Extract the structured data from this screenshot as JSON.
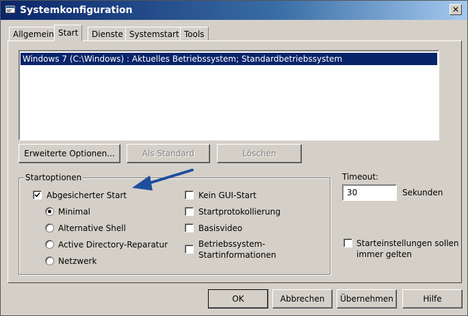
{
  "window": {
    "title": "Systemkonfiguration",
    "close_glyph": "✕"
  },
  "tabs": [
    {
      "label": "Allgemein",
      "active": false
    },
    {
      "label": "Start",
      "active": true
    },
    {
      "label": "Dienste",
      "active": false
    },
    {
      "label": "Systemstart",
      "active": false
    },
    {
      "label": "Tools",
      "active": false
    }
  ],
  "boot_list": {
    "items": [
      "Windows 7 (C:\\Windows) : Aktuelles Betriebssystem; Standardbetriebssystem"
    ],
    "selected_index": 0
  },
  "boot_buttons": {
    "advanced": "Erweiterte Optionen...",
    "set_default": "Als Standard",
    "delete": "Löschen"
  },
  "startoptions": {
    "group_label": "Startoptionen",
    "safe_boot": {
      "label": "Abgesicherter Start",
      "checked": true
    },
    "radios": [
      {
        "label": "Minimal",
        "selected": true
      },
      {
        "label": "Alternative Shell",
        "selected": false
      },
      {
        "label": "Active Directory-Reparatur",
        "selected": false
      },
      {
        "label": "Netzwerk",
        "selected": false
      }
    ],
    "checkboxes": [
      {
        "label": "Kein GUI-Start",
        "checked": false
      },
      {
        "label": "Startprotokollierung",
        "checked": false
      },
      {
        "label": "Basisvideo",
        "checked": false
      },
      {
        "label_line1": "Betriebssystem-",
        "label_line2": "Startinformationen",
        "checked": false
      }
    ]
  },
  "timeout": {
    "label": "Timeout:",
    "value": "30",
    "unit": "Sekunden"
  },
  "persist": {
    "label_line1": "Starteinstellungen sollen",
    "label_line2": "immer gelten",
    "checked": false
  },
  "dialog_buttons": {
    "ok": "OK",
    "cancel": "Abbrechen",
    "apply": "Übernehmen",
    "help": "Hilfe"
  },
  "colors": {
    "selection": "#0a246a",
    "annotation_arrow": "#1f4e9c"
  },
  "icons": [
    "msconfig-icon",
    "close-icon",
    "checkmark-icon",
    "annotation-arrow-icon"
  ]
}
